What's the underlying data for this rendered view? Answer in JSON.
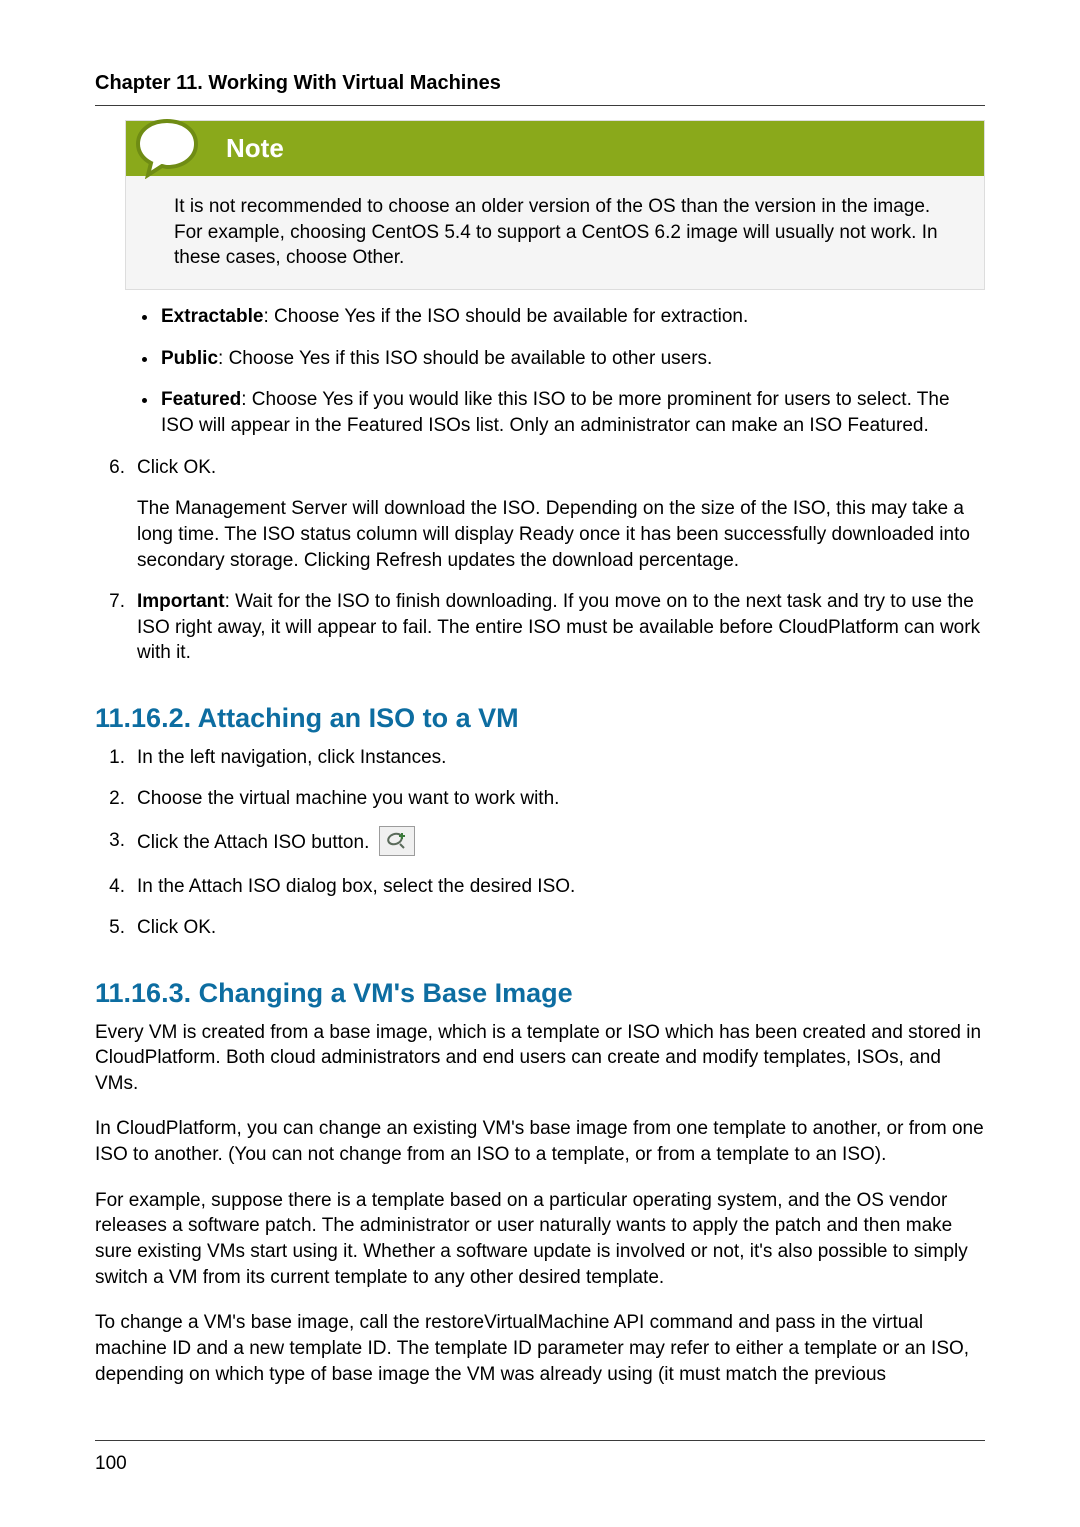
{
  "header": {
    "chapter": "Chapter 11. Working With Virtual Machines"
  },
  "note": {
    "label": "Note",
    "body": "It is not recommended to choose an older version of the OS than the version in the image. For example, choosing CentOS 5.4 to support a CentOS 6.2 image will usually not work. In these cases, choose Other."
  },
  "bullets": [
    {
      "term": "Extractable",
      "text": ": Choose Yes if the ISO should be available for extraction."
    },
    {
      "term": "Public",
      "text": ": Choose Yes if this ISO should be available to other users."
    },
    {
      "term": "Featured",
      "text": ": Choose Yes if you would like this ISO to be more prominent for users to select. The ISO will appear in the Featured ISOs list. Only an administrator can make an ISO Featured."
    }
  ],
  "steps_a": [
    {
      "num": "6.",
      "p1": "Click OK.",
      "p2": "The Management Server will download the ISO. Depending on the size of the ISO, this may take a long time. The ISO status column will display Ready once it has been successfully downloaded into secondary storage. Clicking Refresh updates the download percentage."
    },
    {
      "num": "7.",
      "term": "Important",
      "text": ": Wait for the ISO to finish downloading. If you move on to the next task and try to use the ISO right away, it will appear to fail. The entire ISO must be available before CloudPlatform can work with it."
    }
  ],
  "sec2": {
    "title": "11.16.2. Attaching an ISO to a VM",
    "s1": {
      "num": "1.",
      "text": "In the left navigation, click Instances."
    },
    "s2": {
      "num": "2.",
      "text": "Choose the virtual machine you want to work with."
    },
    "s3": {
      "num": "3.",
      "text": "Click the Attach ISO button."
    },
    "s4": {
      "num": "4.",
      "text": "In the Attach ISO dialog box, select the desired ISO."
    },
    "s5": {
      "num": "5.",
      "text": "Click OK."
    }
  },
  "sec3": {
    "title": "11.16.3. Changing a VM's Base Image",
    "p1": "Every VM is created from a base image, which is a template or ISO which has been created and stored in CloudPlatform. Both cloud administrators and end users can create and modify templates, ISOs, and VMs.",
    "p2": "In CloudPlatform, you can change an existing VM's base image from one template to another, or from one ISO to another. (You can not change from an ISO to a template, or from a template to an ISO).",
    "p3": "For example, suppose there is a template based on a particular operating system, and the OS vendor releases a software patch. The administrator or user naturally wants to apply the patch and then make sure existing VMs start using it. Whether a software update is involved or not, it's also possible to simply switch a VM from its current template to any other desired template.",
    "p4": "To change a VM's base image, call the restoreVirtualMachine API command and pass in the virtual machine ID and a new template ID. The template ID parameter may refer to either a template or an ISO, depending on which type of base image the VM was already using (it must match the previous"
  },
  "page_number": "100"
}
